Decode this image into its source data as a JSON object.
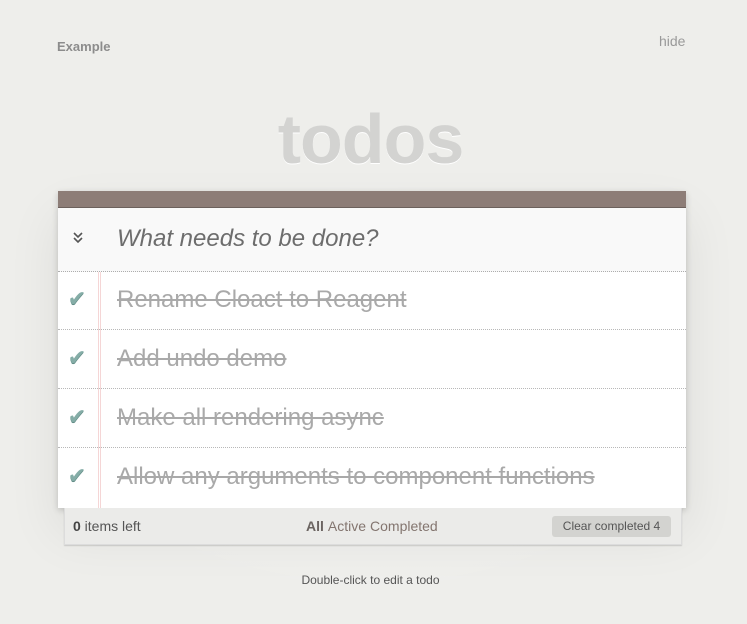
{
  "page": {
    "example_label": "Example",
    "hide_label": "hide",
    "title": "todos"
  },
  "new_todo": {
    "placeholder": "What needs to be done?",
    "value": ""
  },
  "toggle_all_glyph": "»",
  "check_glyph": "✔",
  "todos": [
    {
      "label": "Rename Cloact to Reagent",
      "completed": true
    },
    {
      "label": "Add undo demo",
      "completed": true
    },
    {
      "label": "Make all rendering async",
      "completed": true
    },
    {
      "label": "Allow any arguments to component functions",
      "completed": true
    }
  ],
  "footer": {
    "count": "0",
    "count_suffix": " items left",
    "filters": [
      "All",
      "Active",
      "Completed"
    ],
    "selected_filter": "All",
    "clear_label": "Clear completed 4"
  },
  "info": "Double-click to edit a todo",
  "colors": {
    "background": "#eeeeeb",
    "topbar": "#8d7d77",
    "check": "#85ada7",
    "title": "#d3d3d1"
  },
  "icons": {
    "toggle_all": "double-chevron-down-icon",
    "todo_check": "checkmark-icon"
  }
}
